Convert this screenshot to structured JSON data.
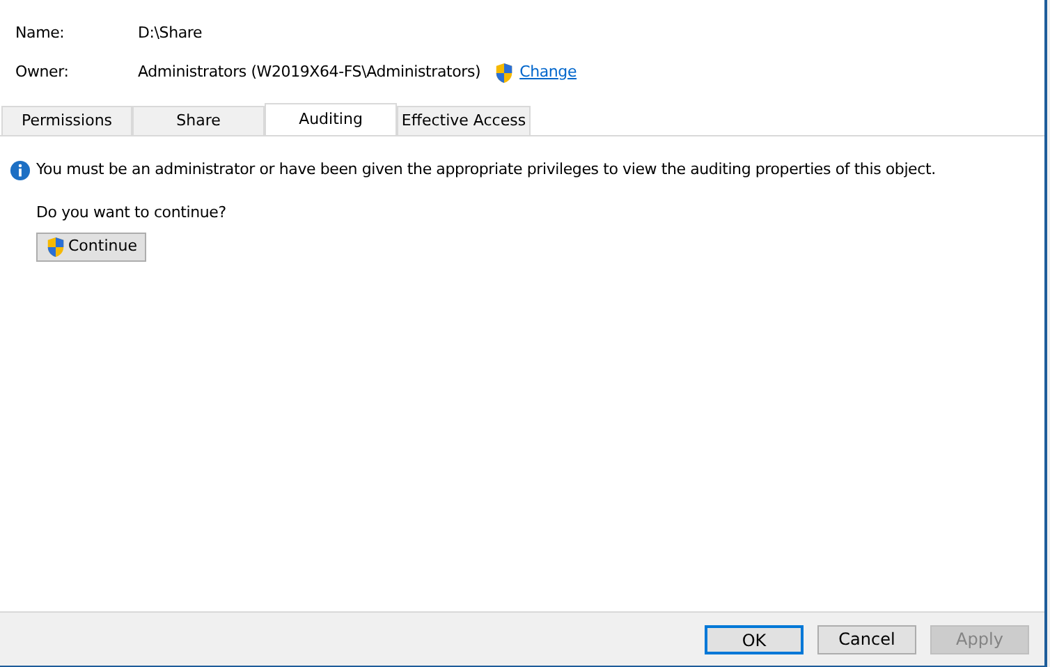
{
  "fields": [
    {
      "label": "Name:",
      "value": "D:\\Share"
    },
    {
      "label": "Owner:",
      "value": "Administrators (W2019X64-FS\\Administrators)",
      "link": "Change"
    }
  ],
  "tabs": [
    {
      "label": "Permissions",
      "selected": false
    },
    {
      "label": "Share",
      "selected": false
    },
    {
      "label": "Auditing",
      "selected": true
    },
    {
      "label": "Effective Access",
      "selected": false
    }
  ],
  "info_message": "You must be an administrator or have been given the appropriate privileges to view the auditing properties of this object.",
  "question": "Do you want to continue?",
  "continue_button": "Continue",
  "buttons": [
    {
      "label": "OK",
      "default": true,
      "disabled": false
    },
    {
      "label": "Cancel",
      "default": false,
      "disabled": false
    },
    {
      "label": "Apply",
      "default": false,
      "disabled": true
    }
  ]
}
